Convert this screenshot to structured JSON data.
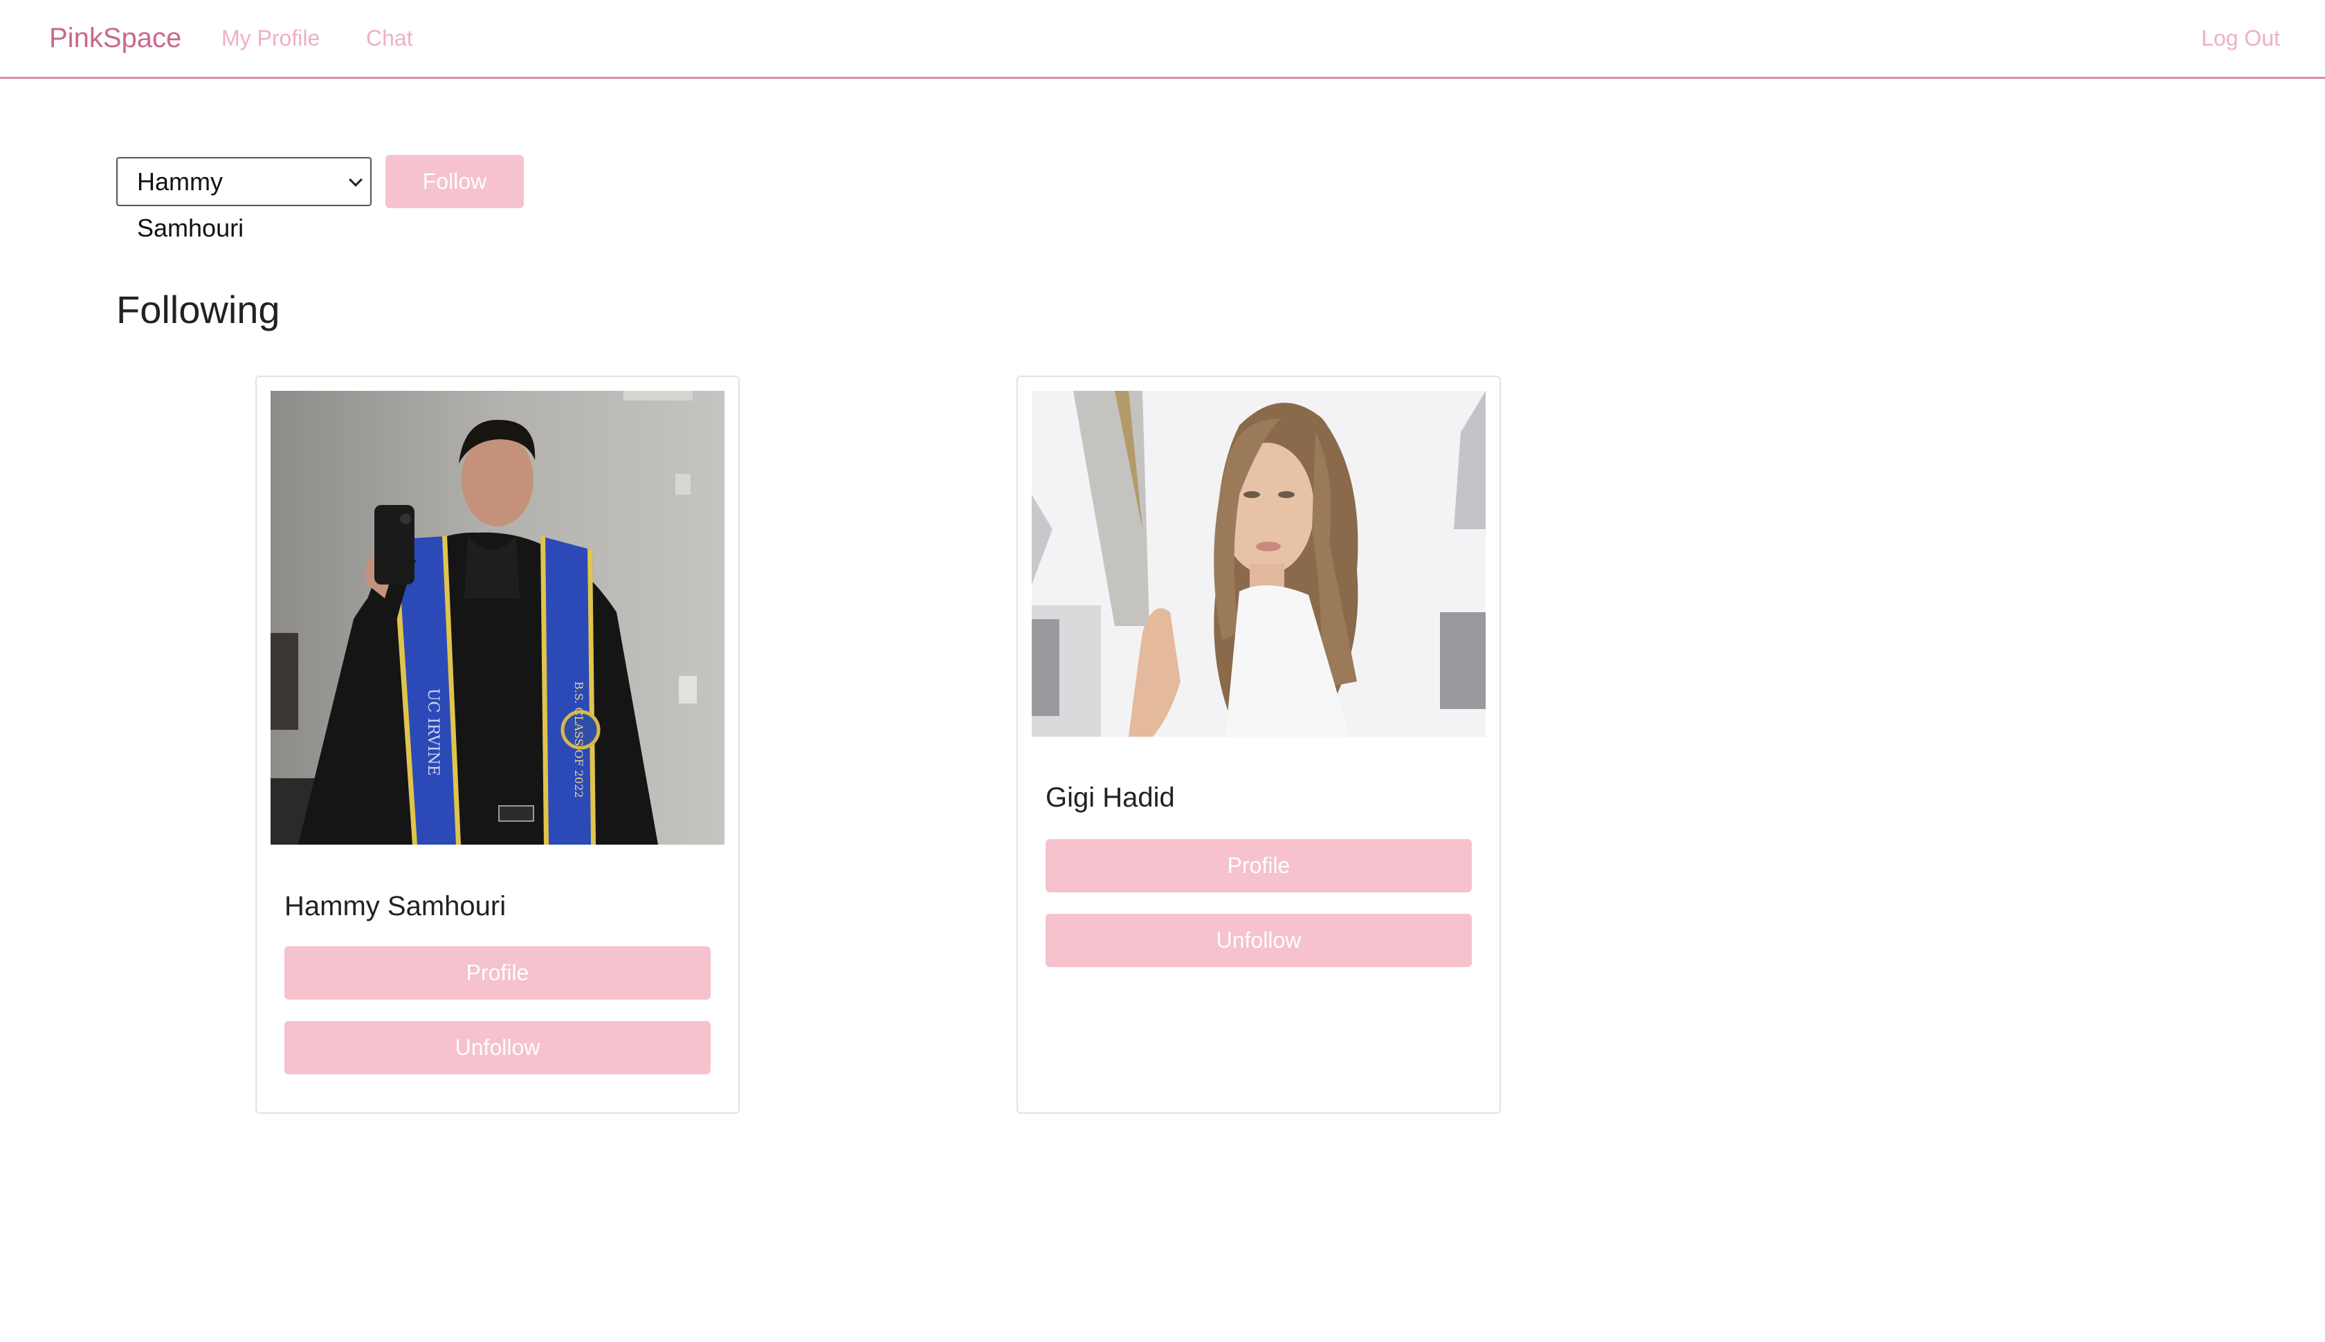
{
  "nav": {
    "brand": "PinkSpace",
    "links": [
      "My Profile",
      "Chat"
    ],
    "logout": "Log Out"
  },
  "follow_form": {
    "selected_user": "Hammy Samhouri",
    "follow_label": "Follow"
  },
  "section_title": "Following",
  "following": [
    {
      "name": "Hammy Samhouri",
      "profile_label": "Profile",
      "unfollow_label": "Unfollow",
      "stole_text_left": "UC IRVINE",
      "stole_text_right": "B.S. CLASS OF 2022"
    },
    {
      "name": "Gigi Hadid",
      "profile_label": "Profile",
      "unfollow_label": "Unfollow"
    }
  ],
  "colors": {
    "brand": "#c9688f",
    "nav_link": "#eeb0c4",
    "button_bg": "#f5c2ce",
    "nav_border": "#d98aa8"
  }
}
